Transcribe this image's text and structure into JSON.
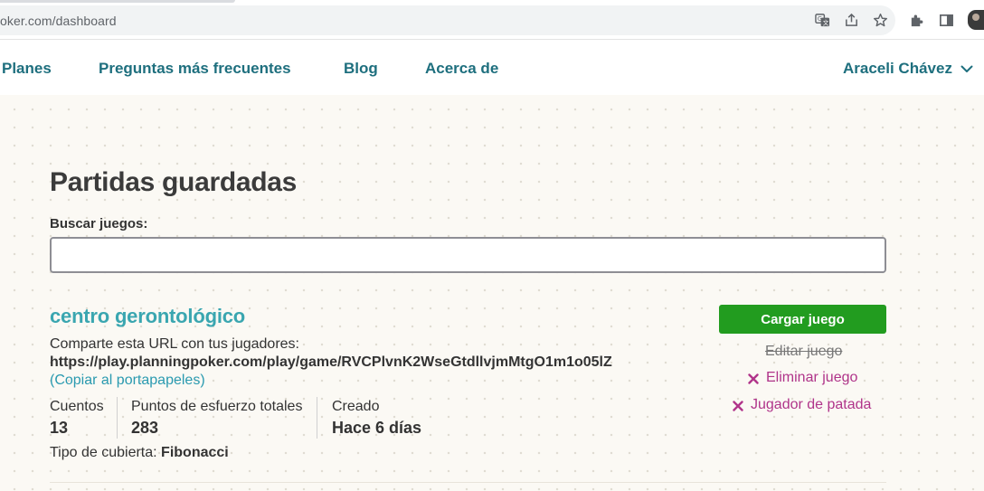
{
  "browser": {
    "url": "oker.com/dashboard",
    "icons": [
      "translate-icon",
      "share-icon",
      "star-icon",
      "extensions-icon",
      "side-panel-icon",
      "profile-avatar"
    ]
  },
  "nav": {
    "links": [
      "Planes",
      "Preguntas más frecuentes",
      "Blog",
      "Acerca de"
    ],
    "user_name": "Araceli Chávez"
  },
  "page": {
    "title": "Partidas guardadas",
    "search_label": "Buscar juegos:",
    "search_value": "",
    "search_placeholder": ""
  },
  "game": {
    "name": "centro gerontológico",
    "share_text": "Comparte esta URL con tus jugadores:",
    "share_url": "https://play.planningpoker.com/play/game/RVCPlvnK2WseGtdllvjmMtgO1m1o05lZ",
    "copy_label": "(Copiar al portapapeles)",
    "stats": [
      {
        "label": "Cuentos",
        "value": "13"
      },
      {
        "label": "Puntos de esfuerzo totales",
        "value": "283"
      },
      {
        "label": "Creado",
        "value": "Hace 6 días"
      }
    ],
    "deck_label": "Tipo de cubierta:",
    "deck_value": "Fibonacci",
    "actions": {
      "load": "Cargar juego",
      "edit": "Editar juego",
      "delete": "Eliminar juego",
      "kick": "Jugador de patada"
    }
  },
  "colors": {
    "nav_text": "#1e6f7e",
    "game_title": "#3aa6b0",
    "load_button": "#229c1f",
    "danger": "#b0348a",
    "background": "#fbf9f4"
  }
}
